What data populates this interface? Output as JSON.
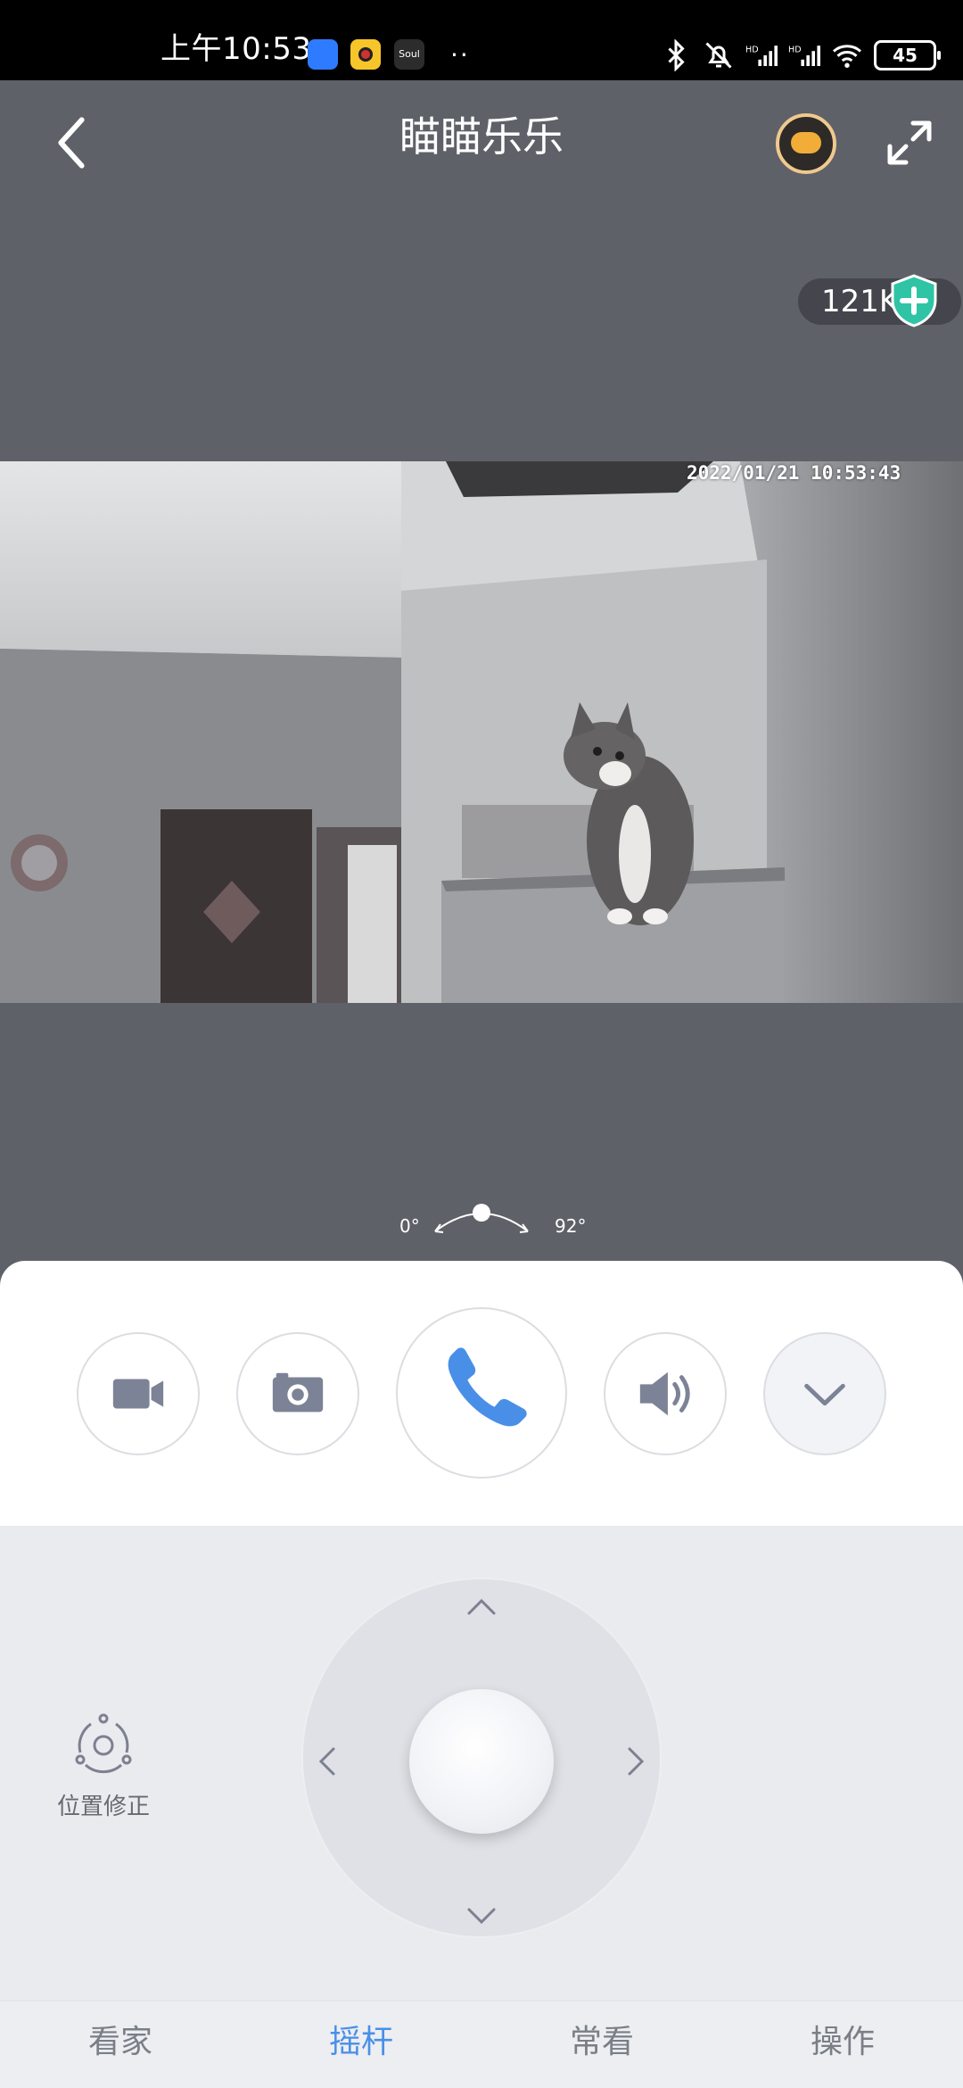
{
  "status_bar": {
    "time": "上午10:53",
    "apps": [
      "baidu-app-icon",
      "video-app-icon",
      "soul-app-icon"
    ],
    "soul_label": "Soul",
    "more": "··",
    "network_hd_1": "HD",
    "network_hd_2": "HD",
    "battery": "45"
  },
  "header": {
    "title": "瞄瞄乐乐",
    "back_icon": "chevron-left-icon",
    "cloud_icon": "cloud-playback-icon",
    "fullscreen_icon": "fullscreen-icon"
  },
  "video": {
    "bitrate": "121K",
    "timestamp": "2022/01/21  10:53:43",
    "angle_min": "0°",
    "angle_max": "92°"
  },
  "controls": {
    "record_icon": "video-record-icon",
    "snapshot_icon": "camera-icon",
    "call_icon": "phone-icon",
    "sound_icon": "speaker-icon",
    "more_icon": "chevron-down-icon"
  },
  "joystick": {
    "position_fix_label": "位置修正"
  },
  "nav": {
    "tabs": [
      {
        "label": "看家",
        "active": false
      },
      {
        "label": "摇杆",
        "active": true
      },
      {
        "label": "常看",
        "active": false
      },
      {
        "label": "操作",
        "active": false
      }
    ]
  },
  "colors": {
    "accent": "#4a8fe7",
    "video_bg": "#5f6168",
    "panel_bg": "#ffffff",
    "joystick_bg": "#e9ebef"
  }
}
